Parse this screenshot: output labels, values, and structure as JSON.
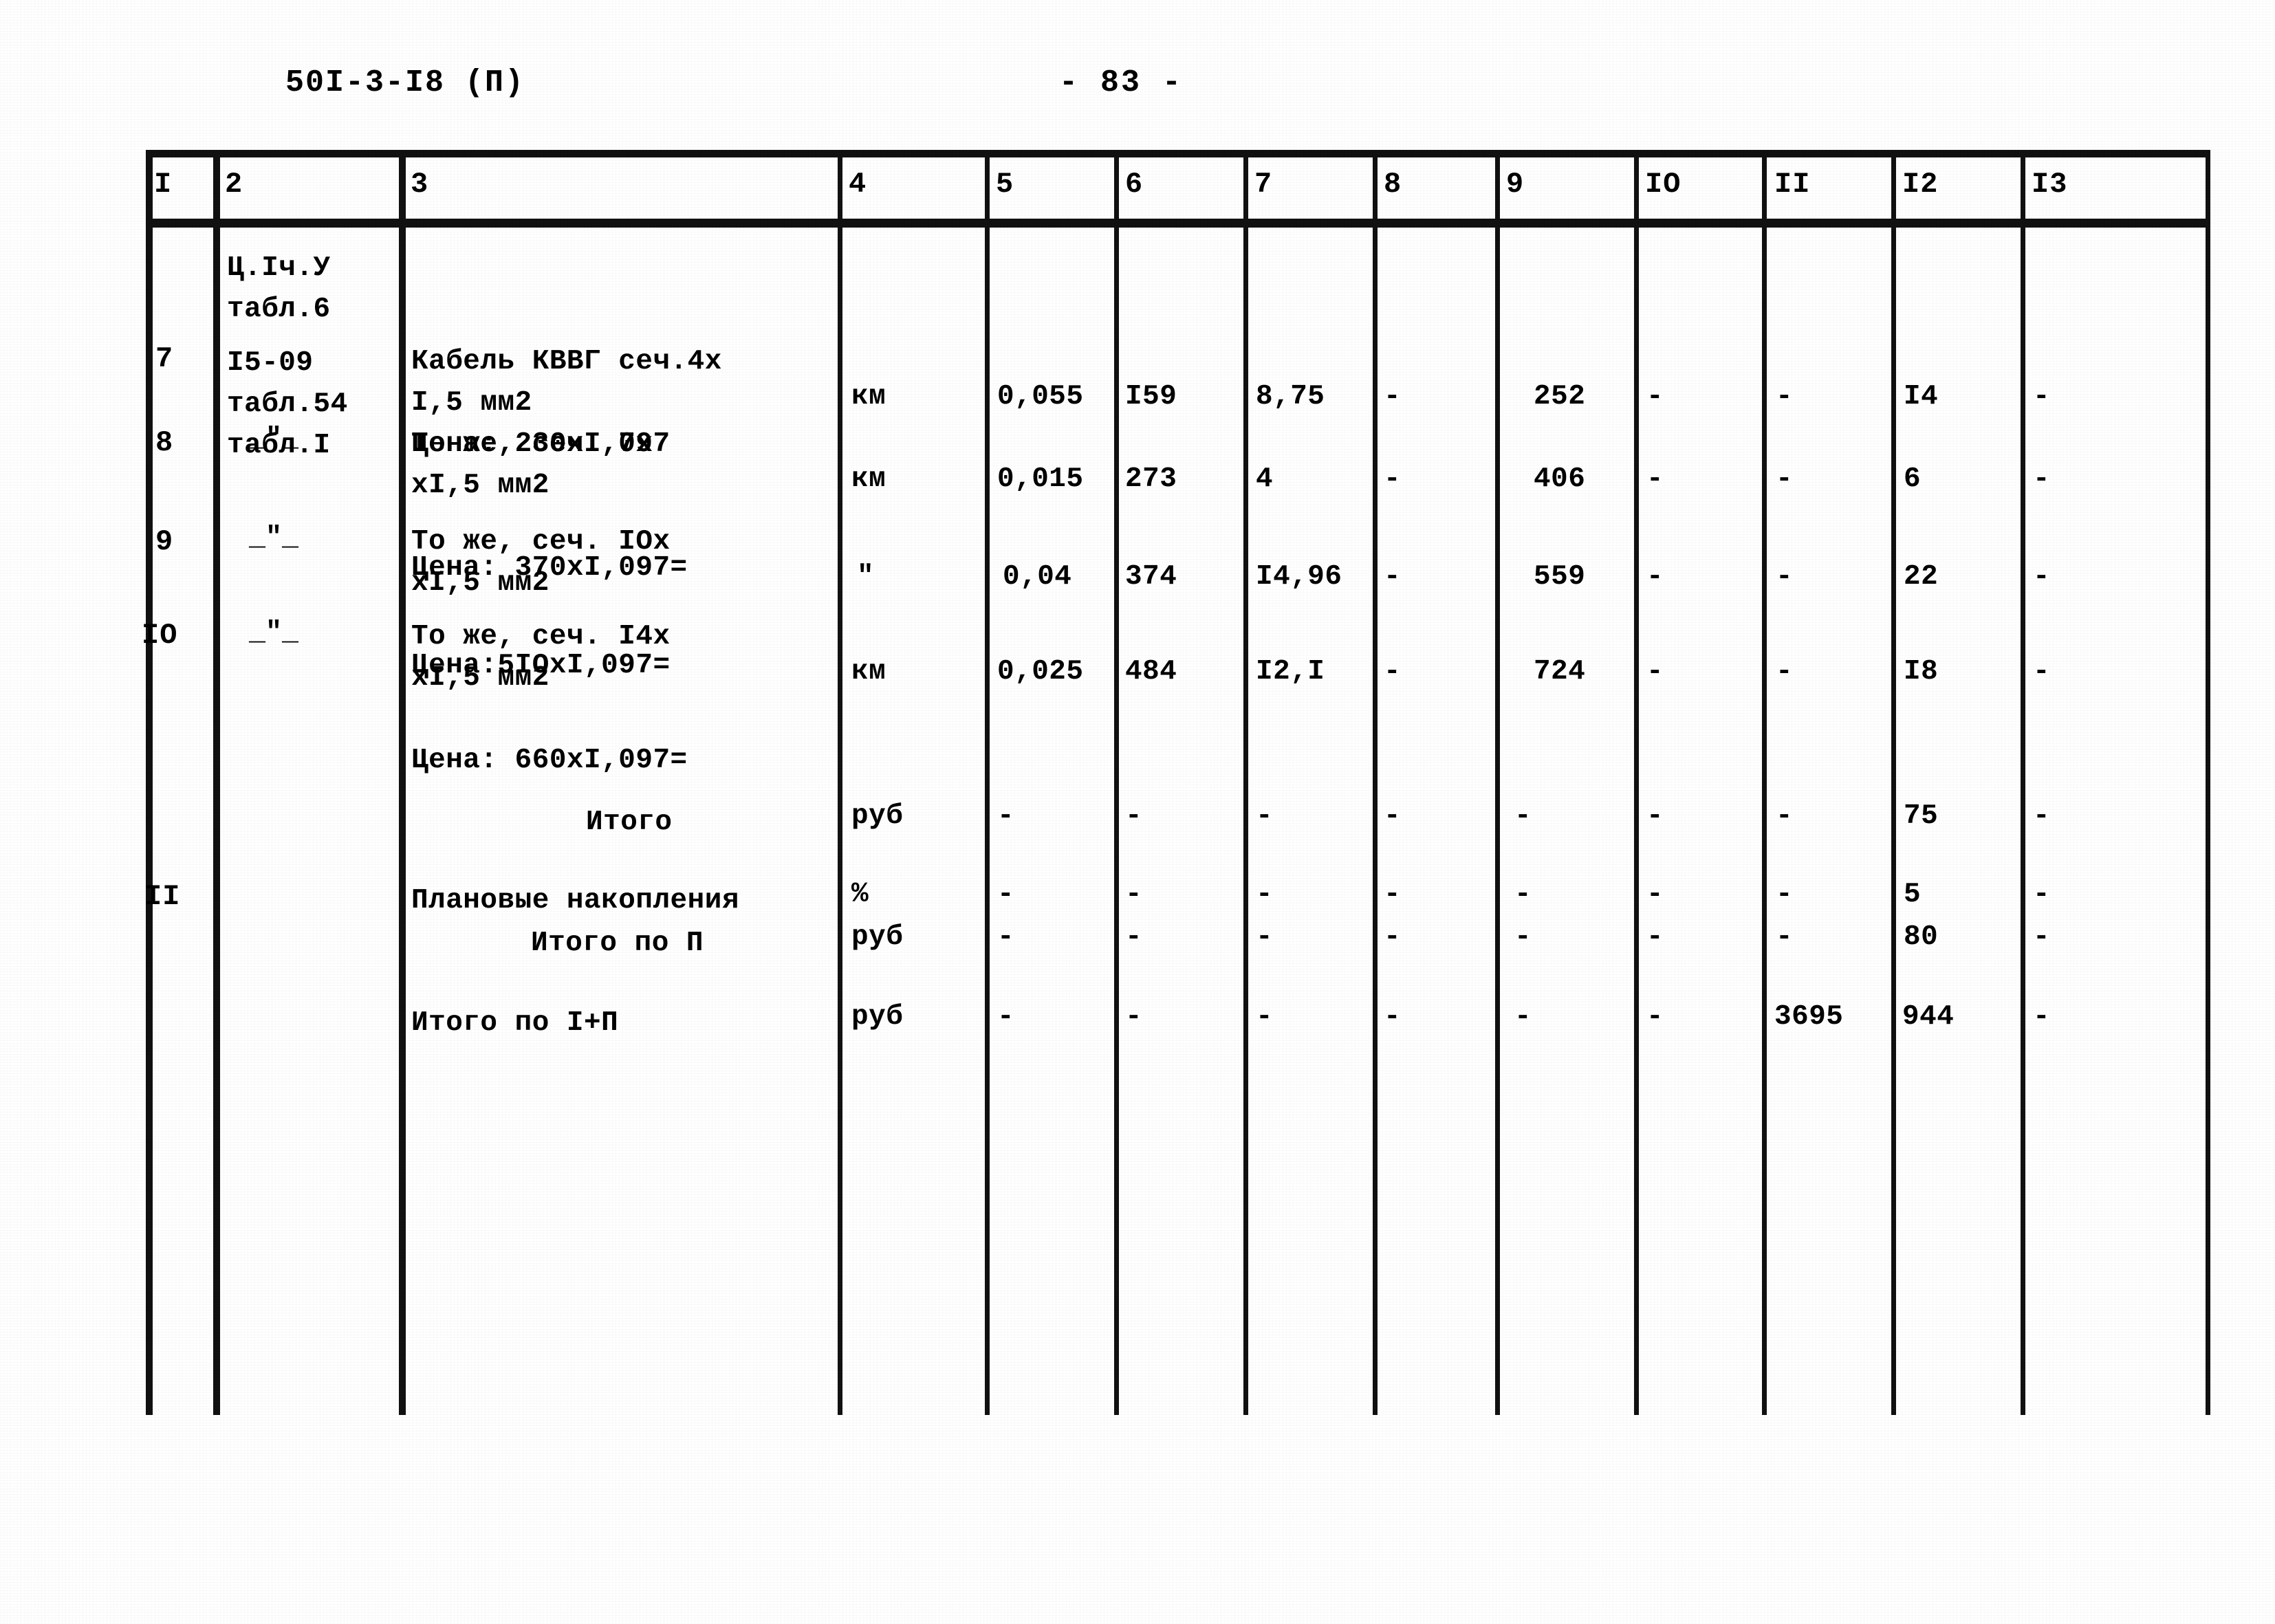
{
  "header": {
    "doc_code": "50I-3-I8 (П)",
    "page_number": "- 83 -"
  },
  "table": {
    "column_headers": [
      "I",
      "2",
      "3",
      "4",
      "5",
      "6",
      "7",
      "8",
      "9",
      "IO",
      "II",
      "I2",
      "I3"
    ],
    "rows": [
      {
        "num": "",
        "ref_lines": [
          "Ц.Iч.У",
          "табл.6"
        ],
        "desc_lines": [],
        "unit": "",
        "c5": "",
        "c6": "",
        "c7": "",
        "c8": "",
        "c9": "",
        "c10": "",
        "c11": "",
        "c12": "",
        "c13": ""
      },
      {
        "num": "7",
        "ref_lines": [
          "I5-09",
          "табл.54",
          "табл.I"
        ],
        "desc_lines": [
          "Кабель КВВГ сеч.4х",
          "I,5 мм2",
          "Цена: 230хI,097"
        ],
        "unit": "км",
        "c5": "0,055",
        "c6": "I59",
        "c7": "8,75",
        "c8": "-",
        "c9": "252",
        "c10": "-",
        "c11": "-",
        "c12": "I4",
        "c13": "-"
      },
      {
        "num": "8",
        "ref_lines": [
          "ditto"
        ],
        "desc_lines": [
          "То же, сеч. 7х",
          "хI,5 мм2",
          "",
          "Цена: 370хI,097="
        ],
        "unit": "км",
        "c5": "0,015",
        "c6": "273",
        "c7": "4",
        "c8": "-",
        "c9": "406",
        "c10": "-",
        "c11": "-",
        "c12": "6",
        "c13": "-"
      },
      {
        "num": "9",
        "ref_lines": [
          "ditto"
        ],
        "desc_lines": [
          "То же, сеч. IOх",
          "хI,5 мм2",
          "",
          "Цена:5IOхI,097="
        ],
        "unit": "\"",
        "c5": "0,04",
        "c6": "374",
        "c7": "I4,96",
        "c8": "-",
        "c9": "559",
        "c10": "-",
        "c11": "-",
        "c12": "22",
        "c13": "-"
      },
      {
        "num": "IO",
        "ref_lines": [
          "ditto"
        ],
        "desc_lines": [
          "То же, сеч. I4х",
          "хI,5 мм2",
          "",
          "Цена: 660хI,097="
        ],
        "unit": "км",
        "c5": "0,025",
        "c6": "484",
        "c7": "I2,I",
        "c8": "-",
        "c9": "724",
        "c10": "-",
        "c11": "-",
        "c12": "I8",
        "c13": "-"
      },
      {
        "num": "",
        "ref_lines": [],
        "desc_lines": [
          "Итого"
        ],
        "unit": "руб",
        "c5": "-",
        "c6": "-",
        "c7": "-",
        "c8": "-",
        "c9": "-",
        "c10": "-",
        "c11": "-",
        "c12": "75",
        "c13": "-"
      },
      {
        "num": "II",
        "ref_lines": [],
        "desc_lines": [
          "Плановые накопления"
        ],
        "unit": "%",
        "c5": "-",
        "c6": "-",
        "c7": "-",
        "c8": "-",
        "c9": "-",
        "c10": "-",
        "c11": "-",
        "c12": "5",
        "c13": "-"
      },
      {
        "num": "",
        "ref_lines": [],
        "desc_lines": [
          "Итого по П"
        ],
        "unit": "руб",
        "c5": "-",
        "c6": "-",
        "c7": "-",
        "c8": "-",
        "c9": "-",
        "c10": "-",
        "c11": "-",
        "c12": "80",
        "c13": "-"
      },
      {
        "num": "",
        "ref_lines": [],
        "desc_lines": [
          "Итого по I+П"
        ],
        "unit": "руб",
        "c5": "-",
        "c6": "-",
        "c7": "-",
        "c8": "-",
        "c9": "-",
        "c10": "-",
        "c11": "3695",
        "c12": "944",
        "c13": "-"
      }
    ],
    "cells": {
      "r0_ref_l1": "Ц.Iч.У",
      "r0_ref_l2": "табл.6",
      "r7_num": "7",
      "r7_ref_l1": "I5-09",
      "r7_ref_l2": "табл.54",
      "r7_ref_l3": "табл.I",
      "r7_desc_l1": "Кабель КВВГ сеч.4х",
      "r7_desc_l2": "I,5 мм2",
      "r7_desc_l3": "Цена: 230хI,097",
      "r7_unit": "км",
      "r7_c5": "0,055",
      "r7_c6": "I59",
      "r7_c7": "8,75",
      "r7_c8": "-",
      "r7_c9": "252",
      "r7_c10": "-",
      "r7_c11": "-",
      "r7_c12": "I4",
      "r7_c13": "-",
      "r8_num": "8",
      "r8_desc_l1": "То же, сеч. 7х",
      "r8_desc_l2": "хI,5 мм2",
      "r8_desc_l3": "Цена: 370хI,097=",
      "r8_unit": "км",
      "r8_c5": "0,015",
      "r8_c6": "273",
      "r8_c7": "4",
      "r8_c8": "-",
      "r8_c9": "406",
      "r8_c10": "-",
      "r8_c11": "-",
      "r8_c12": "6",
      "r8_c13": "-",
      "r9_num": "9",
      "r9_desc_l1": "То же, сеч. IOх",
      "r9_desc_l2": "хI,5 мм2",
      "r9_desc_l3": "Цена:5IOхI,097=",
      "r9_unit": "\"",
      "r9_c5": "0,04",
      "r9_c6": "374",
      "r9_c7": "I4,96",
      "r9_c8": "-",
      "r9_c9": "559",
      "r9_c10": "-",
      "r9_c11": "-",
      "r9_c12": "22",
      "r9_c13": "-",
      "r10_num": "IO",
      "r10_desc_l1": "То же, сеч. I4х",
      "r10_desc_l2": "хI,5 мм2",
      "r10_desc_l3": "Цена: 660хI,097=",
      "r10_unit": "км",
      "r10_c5": "0,025",
      "r10_c6": "484",
      "r10_c7": "I2,I",
      "r10_c8": "-",
      "r10_c9": "724",
      "r10_c10": "-",
      "r10_c11": "-",
      "r10_c12": "I8",
      "r10_c13": "-",
      "total1_label": "Итого",
      "total1_unit": "руб",
      "total1_c5": "-",
      "total1_c6": "-",
      "total1_c7": "-",
      "total1_c8": "-",
      "total1_c9": "-",
      "total1_c10": "-",
      "total1_c11": "-",
      "total1_c12": "75",
      "total1_c13": "-",
      "r11_num": "II",
      "r11_label": "Плановые накопления",
      "r11_unit": "%",
      "r11_c5": "-",
      "r11_c6": "-",
      "r11_c7": "-",
      "r11_c8": "-",
      "r11_c9": "-",
      "r11_c10": "-",
      "r11_c11": "-",
      "r11_c12": "5",
      "r11_c13": "-",
      "total2_label": "Итого по П",
      "total2_unit": "руб",
      "total2_c5": "-",
      "total2_c6": "-",
      "total2_c7": "-",
      "total2_c8": "-",
      "total2_c9": "-",
      "total2_c10": "-",
      "total2_c11": "-",
      "total2_c12": "80",
      "total2_c13": "-",
      "total3_label": "Итого по I+П",
      "total3_unit": "руб",
      "total3_c5": "-",
      "total3_c6": "-",
      "total3_c7": "-",
      "total3_c8": "-",
      "total3_c9": "-",
      "total3_c10": "-",
      "total3_c11": "3695",
      "total3_c12": "944",
      "total3_c13": "-",
      "ditto8": "_\"_",
      "ditto9": "_\"_",
      "ditto10": "_\"_"
    }
  }
}
